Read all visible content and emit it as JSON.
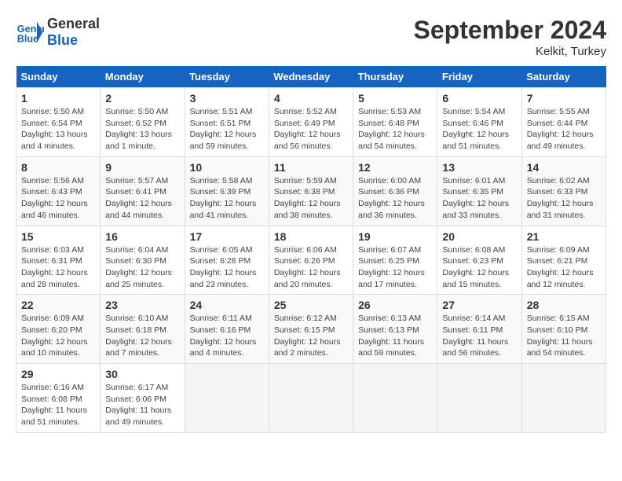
{
  "header": {
    "logo_line1": "General",
    "logo_line2": "Blue",
    "month": "September 2024",
    "location": "Kelkit, Turkey"
  },
  "weekdays": [
    "Sunday",
    "Monday",
    "Tuesday",
    "Wednesday",
    "Thursday",
    "Friday",
    "Saturday"
  ],
  "weeks": [
    [
      {
        "day": "1",
        "info": "Sunrise: 5:50 AM\nSunset: 6:54 PM\nDaylight: 13 hours\nand 4 minutes."
      },
      {
        "day": "2",
        "info": "Sunrise: 5:50 AM\nSunset: 6:52 PM\nDaylight: 13 hours\nand 1 minute."
      },
      {
        "day": "3",
        "info": "Sunrise: 5:51 AM\nSunset: 6:51 PM\nDaylight: 12 hours\nand 59 minutes."
      },
      {
        "day": "4",
        "info": "Sunrise: 5:52 AM\nSunset: 6:49 PM\nDaylight: 12 hours\nand 56 minutes."
      },
      {
        "day": "5",
        "info": "Sunrise: 5:53 AM\nSunset: 6:48 PM\nDaylight: 12 hours\nand 54 minutes."
      },
      {
        "day": "6",
        "info": "Sunrise: 5:54 AM\nSunset: 6:46 PM\nDaylight: 12 hours\nand 51 minutes."
      },
      {
        "day": "7",
        "info": "Sunrise: 5:55 AM\nSunset: 6:44 PM\nDaylight: 12 hours\nand 49 minutes."
      }
    ],
    [
      {
        "day": "8",
        "info": "Sunrise: 5:56 AM\nSunset: 6:43 PM\nDaylight: 12 hours\nand 46 minutes."
      },
      {
        "day": "9",
        "info": "Sunrise: 5:57 AM\nSunset: 6:41 PM\nDaylight: 12 hours\nand 44 minutes."
      },
      {
        "day": "10",
        "info": "Sunrise: 5:58 AM\nSunset: 6:39 PM\nDaylight: 12 hours\nand 41 minutes."
      },
      {
        "day": "11",
        "info": "Sunrise: 5:59 AM\nSunset: 6:38 PM\nDaylight: 12 hours\nand 38 minutes."
      },
      {
        "day": "12",
        "info": "Sunrise: 6:00 AM\nSunset: 6:36 PM\nDaylight: 12 hours\nand 36 minutes."
      },
      {
        "day": "13",
        "info": "Sunrise: 6:01 AM\nSunset: 6:35 PM\nDaylight: 12 hours\nand 33 minutes."
      },
      {
        "day": "14",
        "info": "Sunrise: 6:02 AM\nSunset: 6:33 PM\nDaylight: 12 hours\nand 31 minutes."
      }
    ],
    [
      {
        "day": "15",
        "info": "Sunrise: 6:03 AM\nSunset: 6:31 PM\nDaylight: 12 hours\nand 28 minutes."
      },
      {
        "day": "16",
        "info": "Sunrise: 6:04 AM\nSunset: 6:30 PM\nDaylight: 12 hours\nand 25 minutes."
      },
      {
        "day": "17",
        "info": "Sunrise: 6:05 AM\nSunset: 6:28 PM\nDaylight: 12 hours\nand 23 minutes."
      },
      {
        "day": "18",
        "info": "Sunrise: 6:06 AM\nSunset: 6:26 PM\nDaylight: 12 hours\nand 20 minutes."
      },
      {
        "day": "19",
        "info": "Sunrise: 6:07 AM\nSunset: 6:25 PM\nDaylight: 12 hours\nand 17 minutes."
      },
      {
        "day": "20",
        "info": "Sunrise: 6:08 AM\nSunset: 6:23 PM\nDaylight: 12 hours\nand 15 minutes."
      },
      {
        "day": "21",
        "info": "Sunrise: 6:09 AM\nSunset: 6:21 PM\nDaylight: 12 hours\nand 12 minutes."
      }
    ],
    [
      {
        "day": "22",
        "info": "Sunrise: 6:09 AM\nSunset: 6:20 PM\nDaylight: 12 hours\nand 10 minutes."
      },
      {
        "day": "23",
        "info": "Sunrise: 6:10 AM\nSunset: 6:18 PM\nDaylight: 12 hours\nand 7 minutes."
      },
      {
        "day": "24",
        "info": "Sunrise: 6:11 AM\nSunset: 6:16 PM\nDaylight: 12 hours\nand 4 minutes."
      },
      {
        "day": "25",
        "info": "Sunrise: 6:12 AM\nSunset: 6:15 PM\nDaylight: 12 hours\nand 2 minutes."
      },
      {
        "day": "26",
        "info": "Sunrise: 6:13 AM\nSunset: 6:13 PM\nDaylight: 11 hours\nand 59 minutes."
      },
      {
        "day": "27",
        "info": "Sunrise: 6:14 AM\nSunset: 6:11 PM\nDaylight: 11 hours\nand 56 minutes."
      },
      {
        "day": "28",
        "info": "Sunrise: 6:15 AM\nSunset: 6:10 PM\nDaylight: 11 hours\nand 54 minutes."
      }
    ],
    [
      {
        "day": "29",
        "info": "Sunrise: 6:16 AM\nSunset: 6:08 PM\nDaylight: 11 hours\nand 51 minutes."
      },
      {
        "day": "30",
        "info": "Sunrise: 6:17 AM\nSunset: 6:06 PM\nDaylight: 11 hours\nand 49 minutes."
      },
      null,
      null,
      null,
      null,
      null
    ]
  ]
}
